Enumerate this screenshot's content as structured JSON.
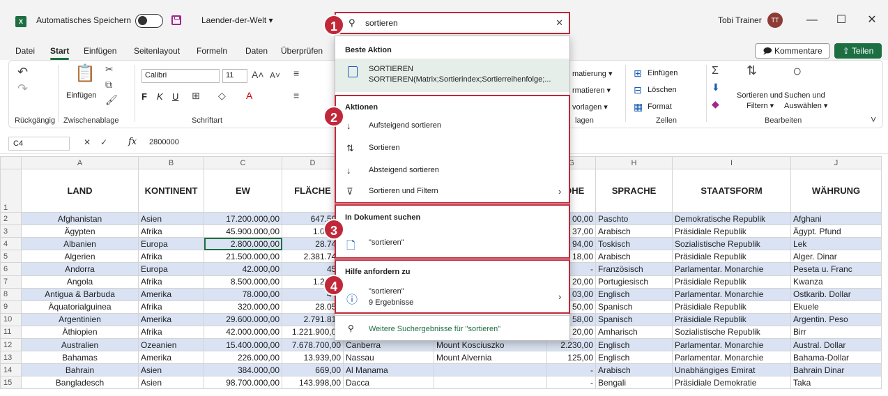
{
  "titlebar": {
    "autosave_label": "Automatisches Speichern",
    "filename": "Laender-der-Welt ▾",
    "user_name": "Tobi Trainer",
    "user_initials": "TT",
    "app_badge": "X"
  },
  "tabs": [
    "Datei",
    "Start",
    "Einfügen",
    "Seitenlayout",
    "Formeln",
    "Daten",
    "Überprüfen"
  ],
  "active_tab": "Start",
  "actions": {
    "comments": "Kommentare",
    "share": "Teilen"
  },
  "ribbon": {
    "undo_group": "Rückgängig",
    "clipboard_group": "Zwischenablage",
    "paste_label": "Einfügen",
    "font_group": "Schriftart",
    "font_name": "Calibri",
    "font_size": "11",
    "bold": "F",
    "italic": "K",
    "underline": "U",
    "styles_partial_1": "matierung ▾",
    "styles_partial_2": "rmatieren ▾",
    "styles_partial_3": "vorlagen ▾",
    "styles_partial_group": "lagen",
    "cells_insert": "Einfügen",
    "cells_delete": "Löschen",
    "cells_format": "Format",
    "cells_group": "Zellen",
    "sort_filter_1": "Sortieren und",
    "sort_filter_2": "Filtern ▾",
    "find_select_1": "Suchen und",
    "find_select_2": "Auswählen ▾",
    "edit_group": "Bearbeiten"
  },
  "formula_bar": {
    "cell_ref": "C4",
    "fx": "fx",
    "value": "2800000"
  },
  "search": {
    "query": "sortieren",
    "best_action_header": "Beste Aktion",
    "best_action_title": "SORTIEREN",
    "best_action_sub": "SORTIEREN(Matrix;Sortierindex;Sortierreihenfolge;...",
    "actions_header": "Aktionen",
    "actions": [
      "Aufsteigend sortieren",
      "Sortieren",
      "Absteigend sortieren",
      "Sortieren und Filtern"
    ],
    "doc_header": "In Dokument suchen",
    "doc_item": "\"sortieren\"",
    "help_header": "Hilfe anfordern zu",
    "help_item": "\"sortieren\"",
    "help_count": "9 Ergebnisse",
    "more_results": "Weitere Suchergebnisse für \"sortieren\"",
    "badges": [
      "1",
      "2",
      "3",
      "4"
    ]
  },
  "sheet": {
    "columns": [
      "A",
      "B",
      "C",
      "D",
      "E",
      "F",
      "G",
      "H",
      "I",
      "J"
    ],
    "headers": [
      "LAND",
      "KONTINENT",
      "EW",
      "FLÄCHE",
      "",
      "",
      "HÖHE",
      "SPRACHE",
      "STAATSFORM",
      "WÄHRUNG"
    ],
    "rows": [
      [
        "Afghanistan",
        "Asien",
        "17.200.000,00",
        "647.500",
        "",
        "",
        "00,00",
        "Paschto",
        "Demokratische Republik",
        "Afghani"
      ],
      [
        "Ägypten",
        "Afrika",
        "45.900.000,00",
        "1.000.0",
        "",
        "",
        "37,00",
        "Arabisch",
        "Präsidiale Republik",
        "Ägypt. Pfund"
      ],
      [
        "Albanien",
        "Europa",
        "2.800.000,00",
        "28.748",
        "",
        "",
        "94,00",
        "Toskisch",
        "Sozialistische Republik",
        "Lek"
      ],
      [
        "Algerien",
        "Afrika",
        "21.500.000,00",
        "2.381.741",
        "",
        "",
        "18,00",
        "Arabisch",
        "Präsidiale Republik",
        "Alger. Dinar"
      ],
      [
        "Andorra",
        "Europa",
        "42.000,00",
        "453",
        "",
        "",
        "-",
        "Französisch",
        "Parlamentar. Monarchie",
        "Peseta u. Franc"
      ],
      [
        "Angola",
        "Afrika",
        "8.500.000,00",
        "1.246.7",
        "",
        "",
        "20,00",
        "Portugiesisch",
        "Präsidiale Republik",
        "Kwanza"
      ],
      [
        "Antigua & Barbuda",
        "Amerika",
        "78.000,00",
        "442",
        "",
        "",
        "03,00",
        "Englisch",
        "Parlamentar. Monarchie",
        "Ostkarib. Dollar"
      ],
      [
        "Äquatorialguinea",
        "Afrika",
        "320.000,00",
        "28.050",
        "",
        "",
        "50,00",
        "Spanisch",
        "Präsidiale Republik",
        "Ekuele"
      ],
      [
        "Argentinien",
        "Amerika",
        "29.600.000,00",
        "2.791.810",
        "",
        "",
        "58,00",
        "Spanisch",
        "Präsidiale Republik",
        "Argentin. Peso"
      ],
      [
        "Äthiopien",
        "Afrika",
        "42.000.000,00",
        "1.221.900,00",
        "Addis Abeba",
        "Ras Daschan",
        "20,00",
        "Amharisch",
        "Sozialistische Republik",
        "Birr"
      ],
      [
        "Australien",
        "Ozeanien",
        "15.400.000,00",
        "7.678.700,00",
        "Canberra",
        "Mount Kosciuszko",
        "2.230,00",
        "Englisch",
        "Parlamentar. Monarchie",
        "Austral. Dollar"
      ],
      [
        "Bahamas",
        "Amerika",
        "226.000,00",
        "13.939,00",
        "Nassau",
        "Mount Alvernia",
        "125,00",
        "Englisch",
        "Parlamentar. Monarchie",
        "Bahama-Dollar"
      ],
      [
        "Bahrain",
        "Asien",
        "384.000,00",
        "669,00",
        "Al Manama",
        "",
        "-",
        "Arabisch",
        "Unabhängiges Emirat",
        "Bahrain Dinar"
      ],
      [
        "Bangladesch",
        "Asien",
        "98.700.000,00",
        "143.998,00",
        "Dacca",
        "",
        "-",
        "Bengali",
        "Präsidiale Demokratie",
        "Taka"
      ]
    ]
  },
  "colors": {
    "accent": "#1d6f42",
    "highlight": "#c0283a",
    "band": "#dae3f3"
  }
}
